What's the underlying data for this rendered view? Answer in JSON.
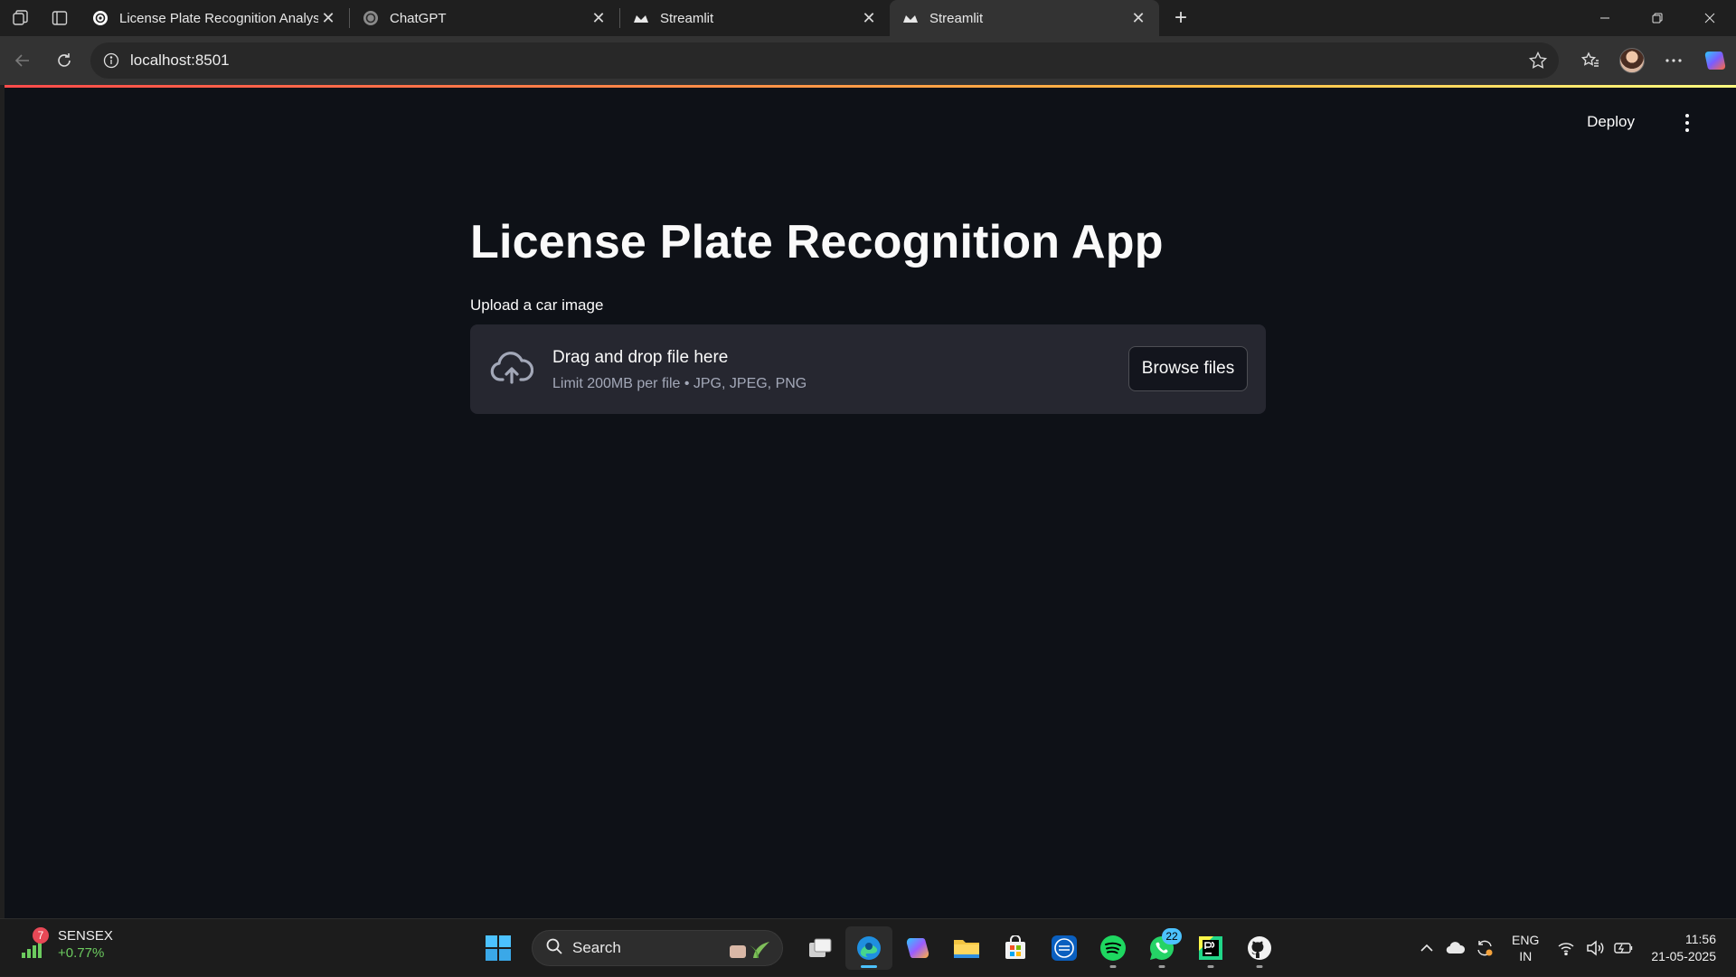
{
  "browser": {
    "tabs": [
      {
        "title": "License Plate Recognition Analysis",
        "favicon": "openai-icon",
        "active": false
      },
      {
        "title": "ChatGPT",
        "favicon": "openai-icon",
        "active": false
      },
      {
        "title": "Streamlit",
        "favicon": "streamlit-icon",
        "active": false
      },
      {
        "title": "Streamlit",
        "favicon": "streamlit-icon",
        "active": true
      }
    ],
    "url": "localhost:8501"
  },
  "app": {
    "deploy_label": "Deploy",
    "title": "License Plate Recognition App",
    "uploader": {
      "label": "Upload a car image",
      "drop_text": "Drag and drop file here",
      "limit_text": "Limit 200MB per file • JPG, JPEG, PNG",
      "browse_label": "Browse files"
    }
  },
  "taskbar": {
    "widget": {
      "badge": "7",
      "name": "SENSEX",
      "value": "+0.77%"
    },
    "search_placeholder": "Search",
    "whatsapp_badge": "22",
    "language": {
      "line1": "ENG",
      "line2": "IN"
    },
    "clock": {
      "time": "11:56",
      "date": "21-05-2025"
    }
  },
  "colors": {
    "page_bg": "#0e1117",
    "uploader_bg": "#262730",
    "streamlit_gradient": [
      "#ff4b4b",
      "#ffbd45",
      "#fffd80"
    ],
    "taskbar_accent": "#4cc2ff"
  }
}
